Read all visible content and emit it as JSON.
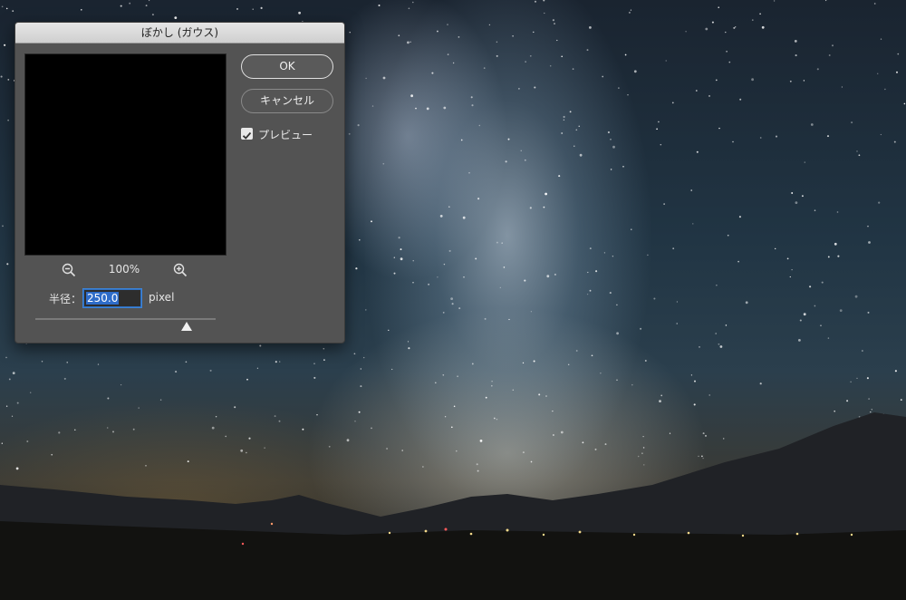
{
  "dialog": {
    "title": "ぼかし (ガウス)",
    "ok_label": "OK",
    "cancel_label": "キャンセル",
    "preview_label": "プレビュー",
    "preview_checked": true,
    "zoom_level": "100%",
    "radius_label": "半径：",
    "radius_value": "250.0",
    "radius_unit": "pixel",
    "slider_fraction": 0.84
  },
  "icons": {
    "zoom_out": "zoom-out-icon",
    "zoom_in": "zoom-in-icon",
    "checkmark": "checkmark-icon"
  },
  "colors": {
    "dialog_bg": "#535353",
    "input_highlight": "#2e6cc9"
  }
}
